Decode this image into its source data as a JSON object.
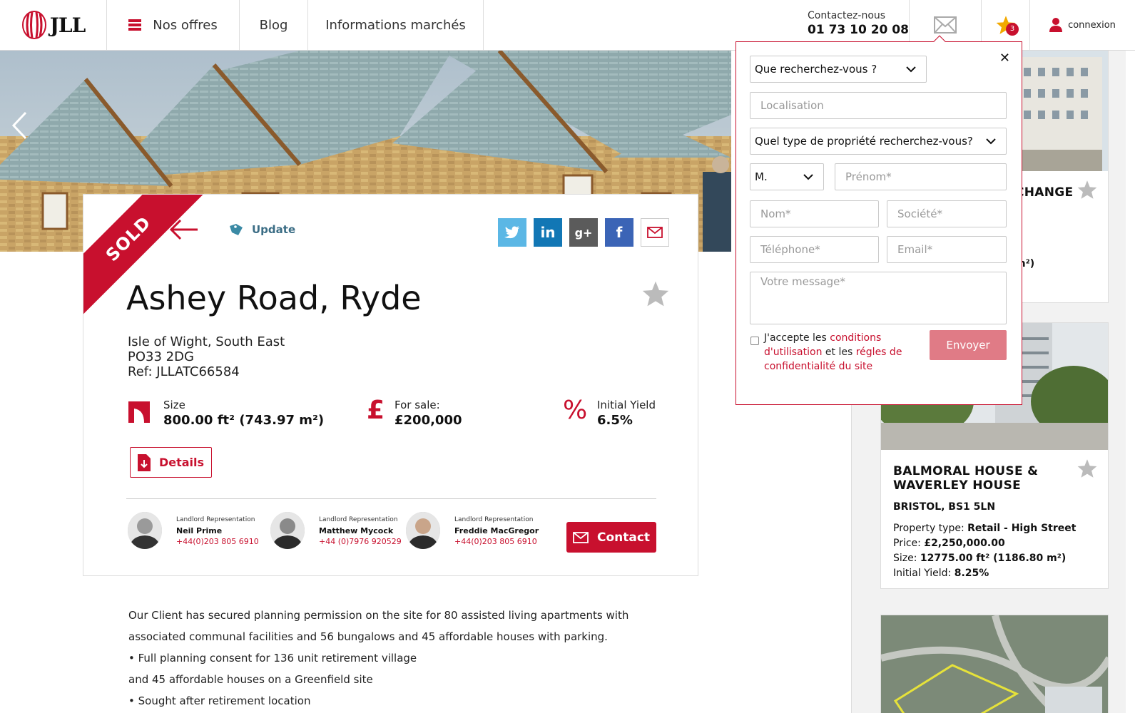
{
  "header": {
    "logo_text": "JLL",
    "nav": [
      "Nos offres",
      "Blog",
      "Informations marchés"
    ],
    "contact_label": "Contactez-nous",
    "contact_phone": "01 73 10 20 08",
    "favorites_count": "3",
    "login_label": "connexion"
  },
  "property": {
    "status": "SOLD",
    "update_label": "Update",
    "title": "Ashey Road, Ryde",
    "address_line1": "Isle of Wight, South East",
    "address_line2": "PO33 2DG",
    "ref": "Ref:  JLLATC66584",
    "size_label": "Size",
    "size_value": "800.00 ft² (743.97 m²)",
    "price_label": "For sale:",
    "price_value": "£200,000",
    "yield_label": "Initial Yield",
    "yield_value": "6.5%",
    "details_label": "Details",
    "contact_label": "Contact",
    "agents": [
      {
        "role": "Landlord Representation",
        "name": "Neil Prime",
        "phone": "+44(0)203 805 6910"
      },
      {
        "role": "Landlord Representation",
        "name": "Matthew Mycock",
        "phone": "+44 (0)7976 920529"
      },
      {
        "role": "Landlord Representation",
        "name": "Freddie MacGregor",
        "phone": "+44(0)203 805 6910"
      }
    ],
    "description": [
      "Our Client has secured planning permission on the site for 80 assisted living apartments with associated communal facilities and 56 bungalows and 45 affordable houses with parking.",
      "• Full planning consent for 136 unit retirement village",
      "and 45 affordable houses on a Greenfield site",
      "• Sought after retirement location"
    ]
  },
  "related": [
    {
      "title_partial": "CHANGE",
      "size_partial": "m²)"
    },
    {
      "title": "BALMORAL HOUSE & WAVERLEY HOUSE",
      "location": "BRISTOL, BS1 5LN",
      "type_label": "Property type:",
      "type_value": "Retail - High Street",
      "price_label": "Price:",
      "price_value": "£2,250,000.00",
      "size_label": "Size:",
      "size_value": "12775.00 ft² (1186.80 m²)",
      "yield_label": "Initial Yield:",
      "yield_value": "8.25%"
    }
  ],
  "popup": {
    "search_select": "Que recherchez-vous ?",
    "location_placeholder": "Localisation",
    "type_select": "Quel type de propriété recherchez-vous?",
    "civility_select": "M.",
    "firstname_placeholder": "Prénom*",
    "lastname_placeholder": "Nom*",
    "company_placeholder": "Société*",
    "phone_placeholder": "Téléphone*",
    "email_placeholder": "Email*",
    "message_placeholder": "Votre message*",
    "accept_text_1": "J'accepte les",
    "accept_link_1": "conditions d'utilisation",
    "accept_text_2": "et les",
    "accept_link_2": "régles de confidentialité du site",
    "send_label": "Envoyer"
  },
  "colors": {
    "brand_red": "#c8102e",
    "send_button": "#e07b86"
  }
}
